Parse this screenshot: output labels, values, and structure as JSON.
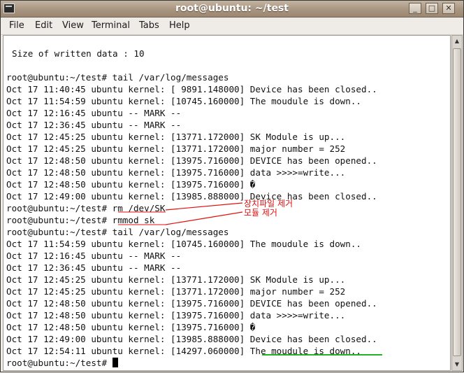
{
  "window": {
    "title": "root@ubuntu: ~/test"
  },
  "controls": {
    "minimize": "_",
    "maximize": "□",
    "close": "✕"
  },
  "menu": [
    "File",
    "Edit",
    "View",
    "Terminal",
    "Tabs",
    "Help"
  ],
  "terminal": {
    "lines": [
      "",
      "Size of written data : 10",
      "",
      "root@ubuntu:~/test# tail /var/log/messages",
      "Oct 17 11:40:45 ubuntu kernel: [ 9891.148000] Device has been closed..",
      "Oct 17 11:54:59 ubuntu kernel: [10745.160000] The moudule is down..",
      "Oct 17 12:16:45 ubuntu -- MARK --",
      "Oct 17 12:36:45 ubuntu -- MARK --",
      "Oct 17 12:45:25 ubuntu kernel: [13771.172000] SK Module is up...",
      "Oct 17 12:45:25 ubuntu kernel: [13771.172000] major number = 252",
      "Oct 17 12:48:50 ubuntu kernel: [13975.716000] DEVICE has been opened..",
      "Oct 17 12:48:50 ubuntu kernel: [13975.716000] data >>>>=write...",
      "Oct 17 12:48:50 ubuntu kernel: [13975.716000] �",
      "Oct 17 12:49:00 ubuntu kernel: [13985.888000] Device has been closed..",
      "root@ubuntu:~/test# rm /dev/SK",
      "root@ubuntu:~/test# rmmod sk",
      "root@ubuntu:~/test# tail /var/log/messages",
      "Oct 17 11:54:59 ubuntu kernel: [10745.160000] The moudule is down..",
      "Oct 17 12:16:45 ubuntu -- MARK --",
      "Oct 17 12:36:45 ubuntu -- MARK --",
      "Oct 17 12:45:25 ubuntu kernel: [13771.172000] SK Module is up...",
      "Oct 17 12:45:25 ubuntu kernel: [13771.172000] major number = 252",
      "Oct 17 12:48:50 ubuntu kernel: [13975.716000] DEVICE has been opened..",
      "Oct 17 12:48:50 ubuntu kernel: [13975.716000] data >>>>=write...",
      "Oct 17 12:48:50 ubuntu kernel: [13975.716000] �",
      "Oct 17 12:49:00 ubuntu kernel: [13985.888000] Device has been closed..",
      "Oct 17 12:54:11 ubuntu kernel: [14297.060000] The moudule is down..",
      "root@ubuntu:~/test# "
    ]
  },
  "annotations": {
    "remove_device_file": "장치파일 제거",
    "remove_module": "모듈 제거"
  },
  "colors": {
    "annotation": "#e01010",
    "highlight_underline": "#22b522"
  }
}
